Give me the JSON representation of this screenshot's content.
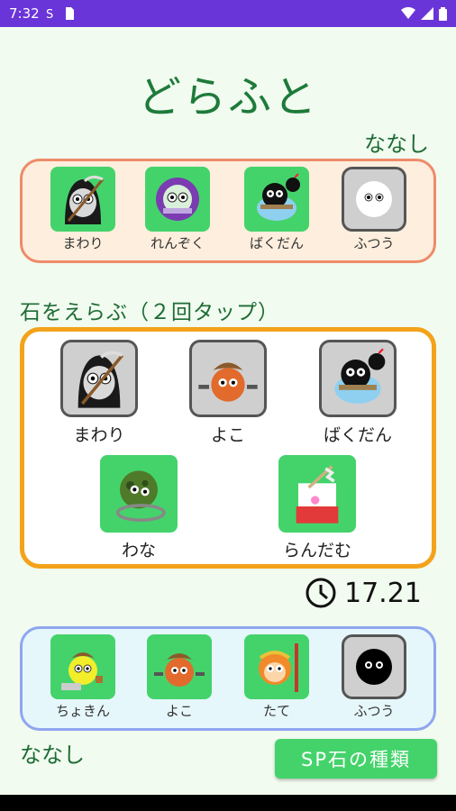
{
  "status_bar": {
    "time": "7:32"
  },
  "app": {
    "title": "どらふと"
  },
  "opponent": {
    "name": "ななし",
    "stones": [
      {
        "label": "まわり",
        "icon": "reaper-icon"
      },
      {
        "label": "れんぞく",
        "icon": "chain-icon"
      },
      {
        "label": "ばくだん",
        "icon": "bomb-icon"
      },
      {
        "label": "ふつう",
        "icon": "plain-white-icon"
      }
    ]
  },
  "select_section": {
    "title": "石をえらぶ（２回タップ）",
    "stones": [
      {
        "label": "まわり",
        "icon": "reaper-icon"
      },
      {
        "label": "よこ",
        "icon": "cowboy-icon"
      },
      {
        "label": "ばくだん",
        "icon": "bomb-icon"
      },
      {
        "label": "わな",
        "icon": "trap-icon"
      },
      {
        "label": "らんだむ",
        "icon": "shrine-maiden-icon"
      }
    ]
  },
  "timer": {
    "value": "17.21"
  },
  "player": {
    "name": "ななし",
    "stones": [
      {
        "label": "ちょきん",
        "icon": "savings-icon"
      },
      {
        "label": "よこ",
        "icon": "cowboy-icon"
      },
      {
        "label": "たて",
        "icon": "monkey-icon"
      },
      {
        "label": "ふつう",
        "icon": "plain-black-icon"
      }
    ]
  },
  "sp_button": {
    "label": "SP石の種類"
  },
  "colors": {
    "status_bar": "#6a35d8",
    "background": "#f1fbef",
    "title_green": "#1e7a3a",
    "tile_green": "#44d36b",
    "opponent_border": "#ee8b6a",
    "select_border": "#f3a21a",
    "player_border": "#8fa6f0"
  }
}
